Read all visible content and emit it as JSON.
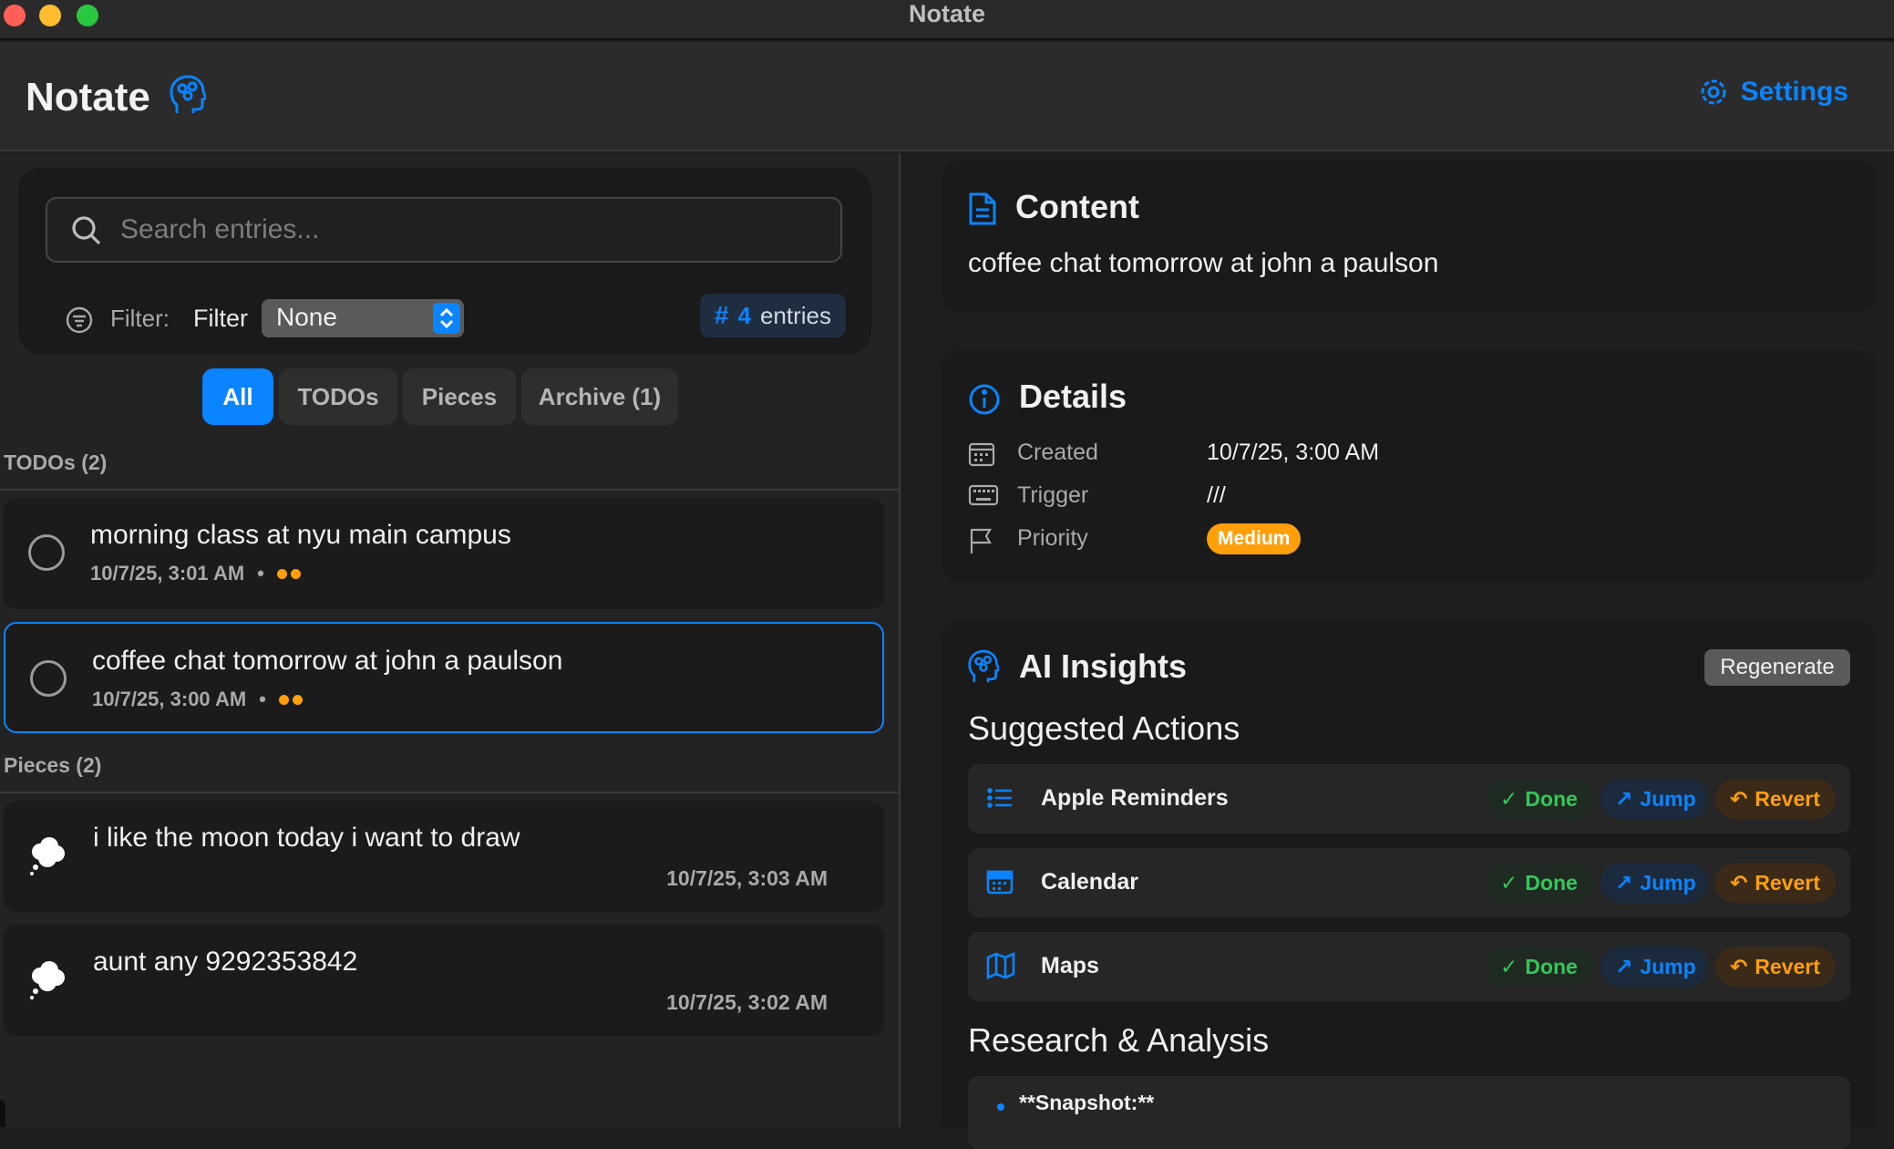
{
  "window": {
    "title": "Notate"
  },
  "header": {
    "app_title": "Notate",
    "settings_label": "Settings"
  },
  "search": {
    "placeholder": "Search entries..."
  },
  "filter": {
    "label": "Filter:",
    "control_label": "Filter",
    "selected": "None",
    "count": "4",
    "count_label": "entries"
  },
  "tabs": [
    "All",
    "TODOs",
    "Pieces",
    "Archive (1)"
  ],
  "todos": {
    "header": "TODOs (2)",
    "items": [
      {
        "title": "morning class at nyu main campus",
        "time": "10/7/25, 3:01 AM",
        "priority_level": "medium"
      },
      {
        "title": "coffee chat tomorrow at john a paulson",
        "time": "10/7/25, 3:00 AM",
        "priority_level": "medium",
        "selected": true
      }
    ]
  },
  "pieces": {
    "header": "Pieces (2)",
    "items": [
      {
        "title": "i like the moon today i want to draw",
        "time": "10/7/25, 3:03 AM"
      },
      {
        "title": "aunt any 9292353842",
        "time": "10/7/25, 3:02 AM"
      }
    ]
  },
  "content": {
    "title": "Content",
    "text": "coffee chat tomorrow at john a paulson"
  },
  "details": {
    "title": "Details",
    "created_label": "Created",
    "created_value": "10/7/25, 3:00 AM",
    "trigger_label": "Trigger",
    "trigger_value": "///",
    "priority_label": "Priority",
    "priority_value": "Medium"
  },
  "ai": {
    "title": "AI Insights",
    "regenerate_label": "Regenerate",
    "suggested_title": "Suggested Actions",
    "actions": [
      {
        "label": "Apple Reminders",
        "icon": "list-icon"
      },
      {
        "label": "Calendar",
        "icon": "calendar-icon"
      },
      {
        "label": "Maps",
        "icon": "map-icon"
      }
    ],
    "done_label": "Done",
    "jump_label": "Jump",
    "revert_label": "Revert",
    "research_title": "Research & Analysis",
    "research_items": [
      "**Snapshot:**"
    ]
  },
  "colors": {
    "accent": "#0a84ff",
    "priority": "#ff9f0a",
    "done": "#34c759"
  }
}
